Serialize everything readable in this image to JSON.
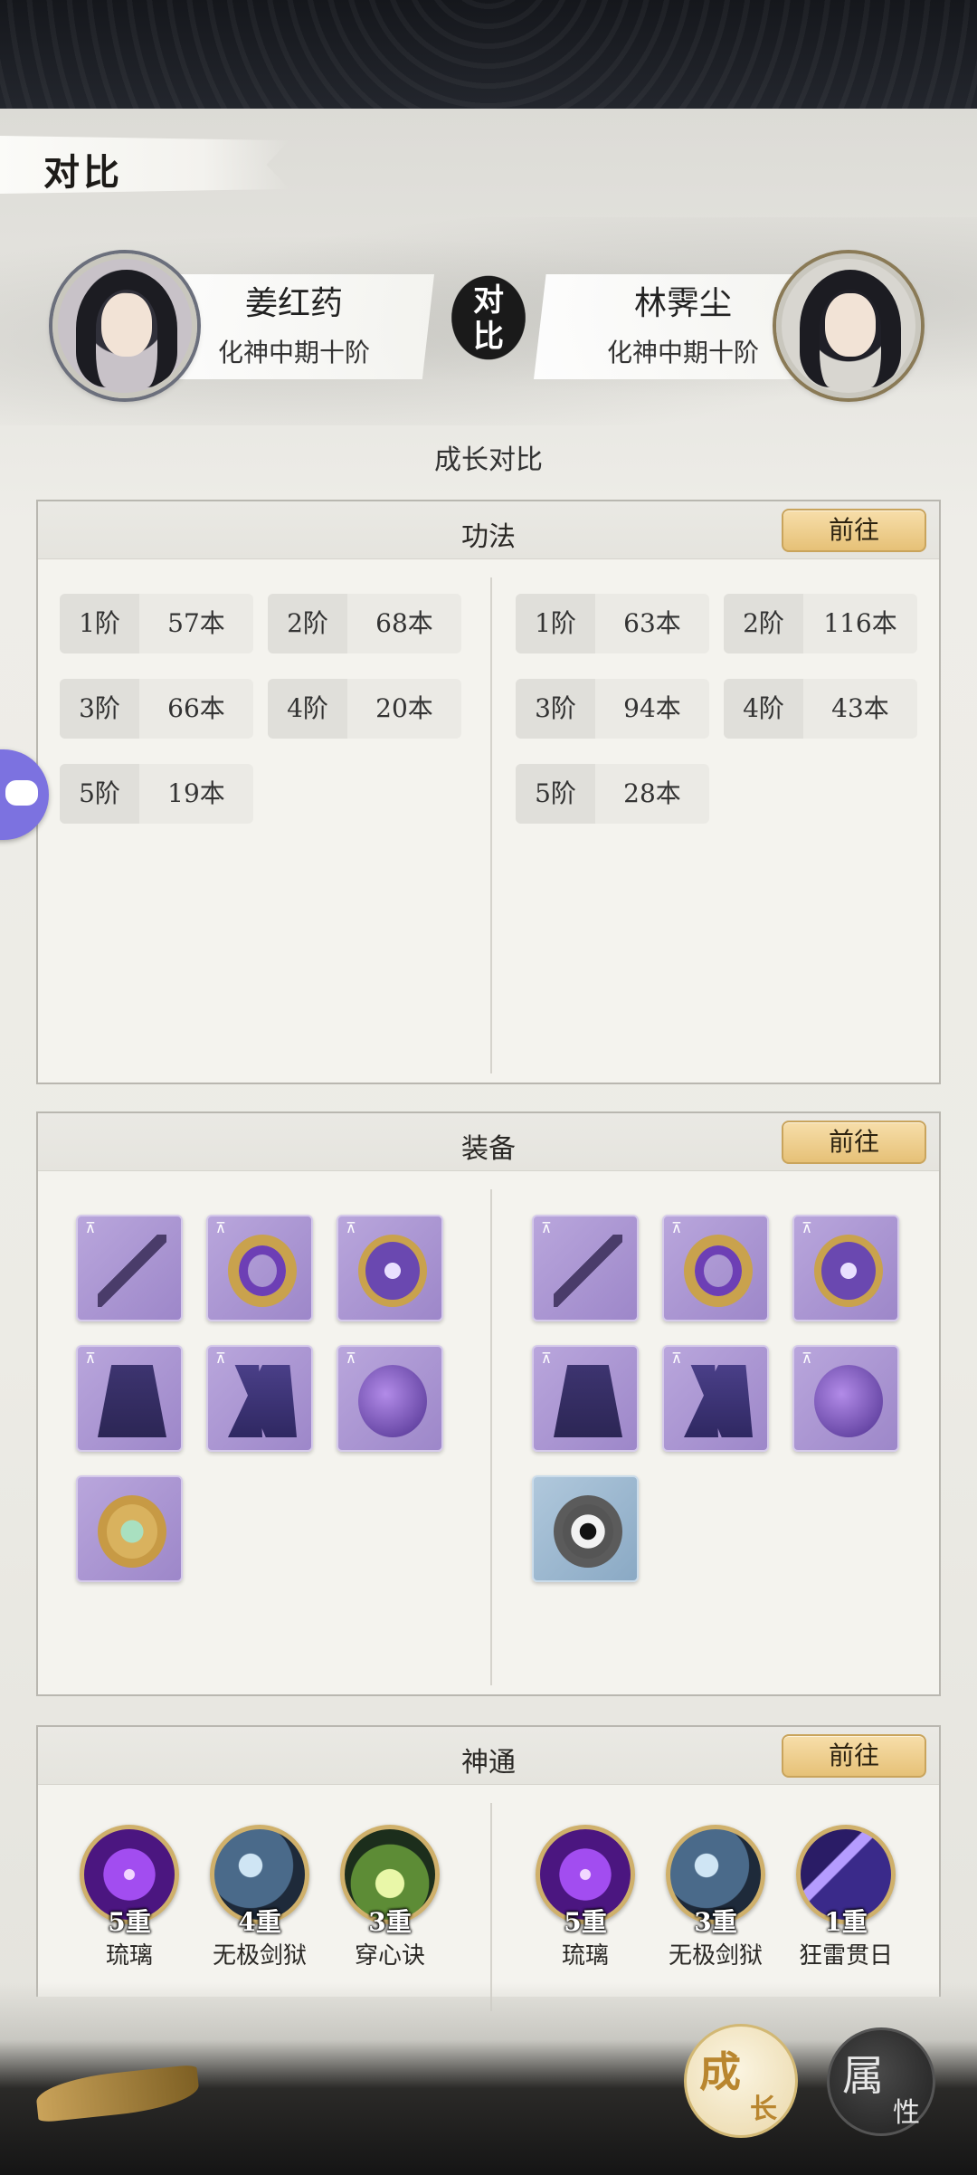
{
  "page": {
    "title": "对比"
  },
  "players": {
    "left": {
      "name": "姜红药",
      "rank": "化神中期十阶"
    },
    "right": {
      "name": "林霁尘",
      "rank": "化神中期十阶"
    },
    "vs_label_top": "对",
    "vs_label_bottom": "比"
  },
  "section": {
    "label": "成长对比"
  },
  "gongfa": {
    "title": "功法",
    "goto_label": "前往",
    "left": [
      {
        "tier": "1阶",
        "count": "57本"
      },
      {
        "tier": "2阶",
        "count": "68本"
      },
      {
        "tier": "3阶",
        "count": "66本"
      },
      {
        "tier": "4阶",
        "count": "20本"
      },
      {
        "tier": "5阶",
        "count": "19本"
      }
    ],
    "right": [
      {
        "tier": "1阶",
        "count": "63本"
      },
      {
        "tier": "2阶",
        "count": "116本"
      },
      {
        "tier": "3阶",
        "count": "94本"
      },
      {
        "tier": "4阶",
        "count": "43本"
      },
      {
        "tier": "5阶",
        "count": "28本"
      }
    ]
  },
  "equipment": {
    "title": "装备",
    "goto_label": "前往",
    "left": [
      "sword",
      "ring",
      "pendant",
      "robe",
      "boots",
      "pouch",
      "gold-charm"
    ],
    "right": [
      "sword",
      "ring",
      "pendant",
      "robe",
      "boots",
      "pouch",
      "bagua-charm"
    ]
  },
  "shentong": {
    "title": "神通",
    "goto_label": "前往",
    "left": [
      {
        "name": "琉璃",
        "level": "5重",
        "icon": "purple-orb"
      },
      {
        "name": "无极剑狱",
        "level": "4重",
        "icon": "sword-orb"
      },
      {
        "name": "穿心诀",
        "level": "3重",
        "icon": "green-flame-orb"
      }
    ],
    "right": [
      {
        "name": "琉璃",
        "level": "5重",
        "icon": "purple-orb"
      },
      {
        "name": "无极剑狱",
        "level": "3重",
        "icon": "sword-orb"
      },
      {
        "name": "狂雷贯日",
        "level": "1重",
        "icon": "lightning-orb"
      }
    ]
  },
  "tabs": {
    "growth": {
      "big": "成",
      "small": "长"
    },
    "attributes": {
      "big": "属",
      "small": "性"
    }
  },
  "colors": {
    "accent_gold": "#e6c177",
    "panel_bg": "#f4f3ee",
    "epic_purple": "#9d87c9"
  }
}
